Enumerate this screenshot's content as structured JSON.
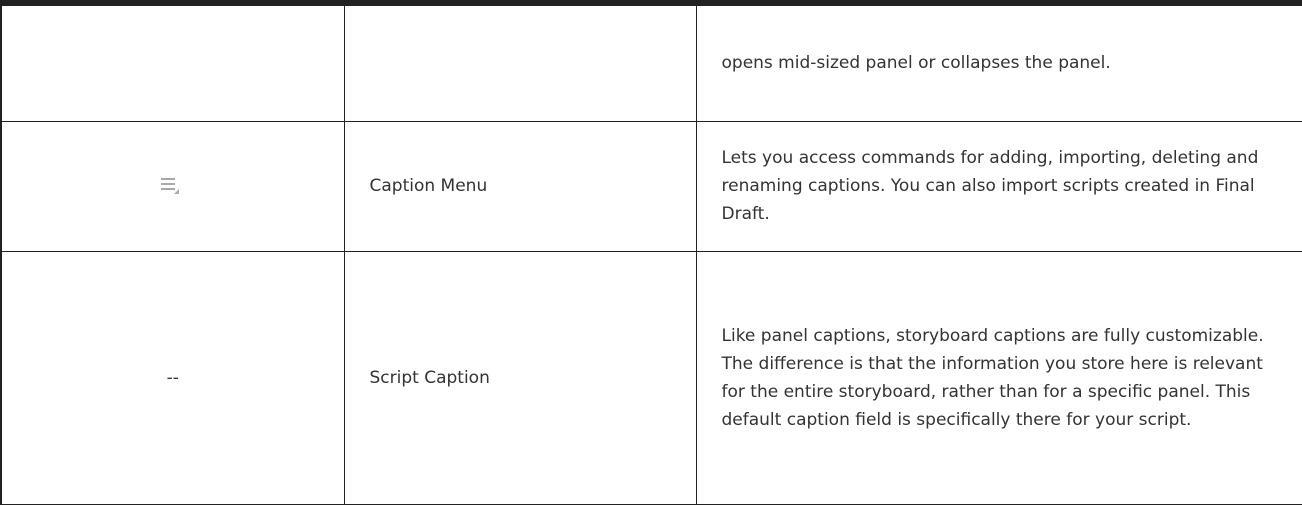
{
  "table": {
    "rows": [
      {
        "icon": "",
        "name": "",
        "description": "opens mid-sized panel or collapses the panel."
      },
      {
        "icon": "caption-menu-icon",
        "name": "Caption Menu",
        "description": "Lets you access commands for adding, importing, deleting and renaming captions. You can also import scripts created in Final Draft."
      },
      {
        "icon_text": "--",
        "name": "Script Caption",
        "description": "Like panel captions, storyboard captions are fully customizable. The difference is that the information you store here is relevant for the entire storyboard, rather than for a specific panel. This default caption field is specifically there for your script."
      }
    ]
  },
  "colors": {
    "border": "#222222",
    "text": "#333333",
    "icon": "#a8a8a8"
  }
}
